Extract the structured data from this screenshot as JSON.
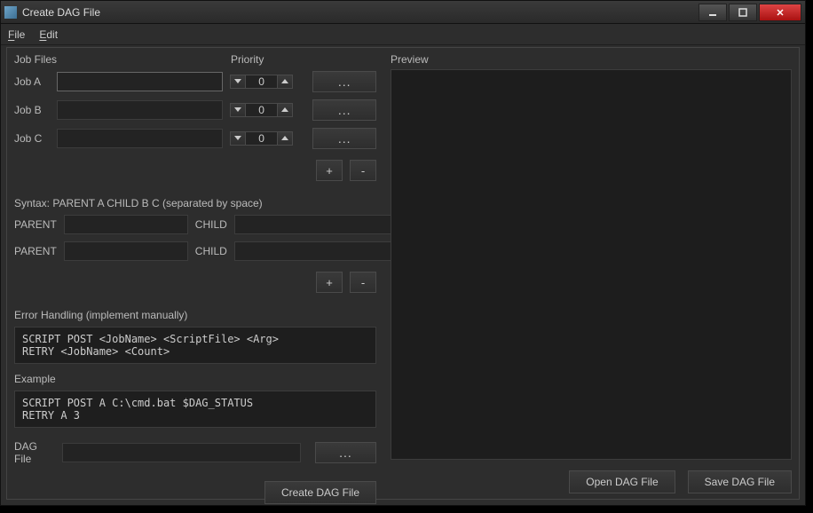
{
  "window": {
    "title": "Create DAG File"
  },
  "menu": {
    "file": "File",
    "edit": "Edit"
  },
  "headers": {
    "jobfiles": "Job Files",
    "priority": "Priority"
  },
  "jobs": [
    {
      "label": "Job A",
      "path": "",
      "priority": "0"
    },
    {
      "label": "Job B",
      "path": "",
      "priority": "0"
    },
    {
      "label": "Job C",
      "path": "",
      "priority": "0"
    }
  ],
  "browse": "...",
  "plus": "+",
  "minus": "-",
  "syntax_label": "Syntax: PARENT A CHILD B C (separated by space)",
  "rel": {
    "parent": "PARENT",
    "child": "CHILD"
  },
  "relations": [
    {
      "parent": "",
      "child": ""
    },
    {
      "parent": "",
      "child": ""
    }
  ],
  "error_label": "Error Handling (implement manually)",
  "error_code": "SCRIPT POST <JobName> <ScriptFile> <Arg>\nRETRY <JobName> <Count>",
  "example_label": "Example",
  "example_code": "SCRIPT POST A C:\\cmd.bat $DAG_STATUS\nRETRY A 3",
  "dagfile_label": "DAG File",
  "dagfile_value": "",
  "buttons": {
    "create": "Create DAG File",
    "open": "Open DAG File",
    "save": "Save DAG File"
  },
  "preview_label": "Preview"
}
